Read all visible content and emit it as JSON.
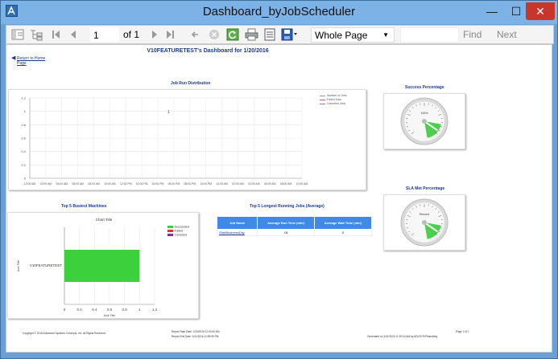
{
  "window": {
    "title": "Dashboard_byJobScheduler",
    "min": "—",
    "max": "☐",
    "close": "✕"
  },
  "toolbar": {
    "page_value": "1",
    "of_label": "of 1",
    "zoom_value": "Whole Page",
    "search_value": "",
    "find_label": "Find",
    "next_label": "Next"
  },
  "report": {
    "title": "V10FEATURETEST's Dashboard for 1/20/2016",
    "back_line1": "Return to Home",
    "back_line2": "Page",
    "job_run_title": "Job Run Distribution",
    "success_title": "Success Percentage",
    "sla_title": "SLA Met Percentage",
    "busiest_title": "Top 5 Busiest Machines",
    "longest_title": "Top 5 Longest Running Jobs (Average)",
    "gauge1_label": "100%",
    "gauge2_label": "Percent"
  },
  "job_run_chart": {
    "type": "line",
    "y_ticks": [
      "1.2",
      "1",
      "0.8",
      "0.6",
      "0.4",
      "0.2",
      "0"
    ],
    "x_ticks": [
      "12:00 AM",
      "02:00 AM",
      "04:00 AM",
      "06:00 AM",
      "08:00 AM",
      "10:00 AM",
      "12:00 PM",
      "02:00 PM",
      "04:00 PM",
      "06:00 PM",
      "08:00 PM",
      "10:00 PM",
      "12:00 AM",
      "02:00 AM",
      "04:00 AM",
      "06:00 AM",
      "08:00 AM",
      "10:00 AM"
    ],
    "legend": [
      "Number of Jobs",
      "Failed Jobs",
      "Canceled Jobs"
    ],
    "annotation": "1",
    "colors": {
      "jobs": "#9a9a9a",
      "failed": "#e05a5a",
      "canceled": "#8080d0"
    }
  },
  "chart_data": {
    "type": "bar",
    "title": "Chart Title",
    "categories": [
      "V10FEATURETEST"
    ],
    "series": [
      {
        "name": "Succeeded",
        "values": [
          1
        ],
        "color": "#3cd13c"
      },
      {
        "name": "Failed",
        "values": [
          0
        ],
        "color": "#e03030"
      },
      {
        "name": "Canceled",
        "values": [
          0
        ],
        "color": "#7a2ea0"
      }
    ],
    "xlabel": "Axis Title",
    "ylabel": "Axis Title",
    "xlim": [
      0,
      1.2
    ],
    "x_ticks": [
      "0",
      "0.2",
      "0.4",
      "0.6",
      "0.8",
      "1",
      "1.2"
    ],
    "orientation": "horizontal"
  },
  "jobs_table": {
    "headers": [
      "Job Name",
      "Average Run Time (min)",
      "Average Wait Time (min)"
    ],
    "rows": [
      [
        "StartBusinessDay",
        ".01",
        "0"
      ]
    ]
  },
  "footer": {
    "copyright": "Copyright © 2016 Advanced Systems Concepts, Inc. All Rights Reserved.",
    "start": "Report Start Date: 1/20/2016 12:00:00 AM",
    "end": "Report End Date: 1/21/2016 11:59:59 PM",
    "page": "Page 1 of 1",
    "generated": "Generated on 1/21/2016 11:20:04 AM by ADVSYS\\Phiamberg"
  }
}
